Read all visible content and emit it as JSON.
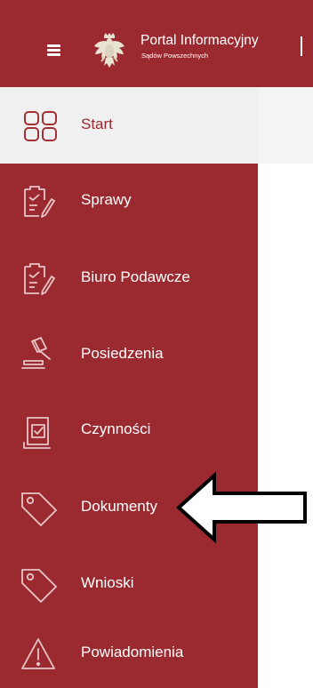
{
  "header": {
    "title": "Portal Informacyjny",
    "subtitle": "Sądów Powszechnych",
    "bg_color": "#9b2a30"
  },
  "nav": {
    "start": {
      "label": "Start",
      "icon": "grid-icon"
    },
    "items": [
      {
        "label": "Sprawy",
        "icon": "clipboard-edit-icon"
      },
      {
        "label": "Biuro Podawcze",
        "icon": "clipboard-edit-icon"
      },
      {
        "label": "Posiedzenia",
        "icon": "gavel-icon"
      },
      {
        "label": "Czynności",
        "icon": "document-check-icon"
      },
      {
        "label": "Dokumenty",
        "icon": "tag-icon"
      },
      {
        "label": "Wnioski",
        "icon": "tag-icon"
      },
      {
        "label": "Powiadomienia",
        "icon": "warning-icon"
      }
    ]
  },
  "annotation": {
    "arrow_icon": "left-arrow-icon"
  }
}
